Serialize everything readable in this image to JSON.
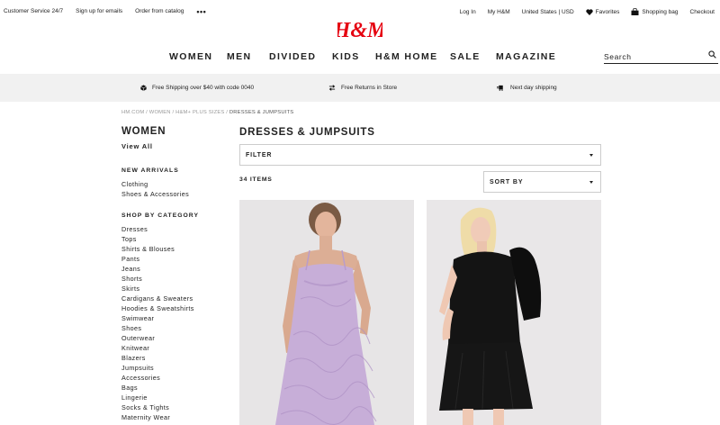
{
  "utility": {
    "left": [
      "Customer Service 24/7",
      "Sign up for emails",
      "Order from catalog"
    ],
    "more": "•••",
    "right": {
      "login": "Log In",
      "myhm": "My H&M",
      "country": "United States | USD",
      "favorites": "Favorites",
      "bag": "Shopping bag",
      "checkout": "Checkout"
    }
  },
  "logo": {
    "text": "H&M",
    "color": "#e50010"
  },
  "nav": [
    "WOMEN",
    "MEN",
    "DIVIDED",
    "KIDS",
    "H&M HOME",
    "SALE",
    "MAGAZINE"
  ],
  "search": {
    "placeholder": "Search"
  },
  "promo": [
    {
      "icon": "box-icon",
      "text": "Free Shipping over $40 with code 0040"
    },
    {
      "icon": "arrows-icon",
      "text": "Free Returns in Store"
    },
    {
      "icon": "delivery-icon",
      "text": "Next day shipping"
    }
  ],
  "breadcrumb": {
    "path": "HM.COM / WOMEN / H&M+ PLUS SIZES / ",
    "current": "DRESSES & JUMPSUITS"
  },
  "sidebar": {
    "heading": "WOMEN",
    "view_all": "View All",
    "new_arrivals": {
      "heading": "NEW ARRIVALS",
      "items": [
        "Clothing",
        "Shoes & Accessories"
      ]
    },
    "shop_by_category": {
      "heading": "SHOP BY CATEGORY",
      "items": [
        "Dresses",
        "Tops",
        "Shirts & Blouses",
        "Pants",
        "Jeans",
        "Shorts",
        "Skirts",
        "Cardigans & Sweaters",
        "Hoodies & Sweatshirts",
        "Swimwear",
        "Shoes",
        "Outerwear",
        "Knitwear",
        "Blazers",
        "Jumpsuits",
        "Accessories",
        "Bags",
        "Lingerie",
        "Socks & Tights",
        "Maternity Wear"
      ]
    }
  },
  "main": {
    "title": "DRESSES & JUMPSUITS",
    "filter_label": "FILTER",
    "item_count": "34 ITEMS",
    "sort_label": "SORT BY"
  },
  "colors": {
    "accent": "#e50010",
    "promo_bg": "#f1f1f1",
    "card_bg": "#e8e6e7"
  }
}
